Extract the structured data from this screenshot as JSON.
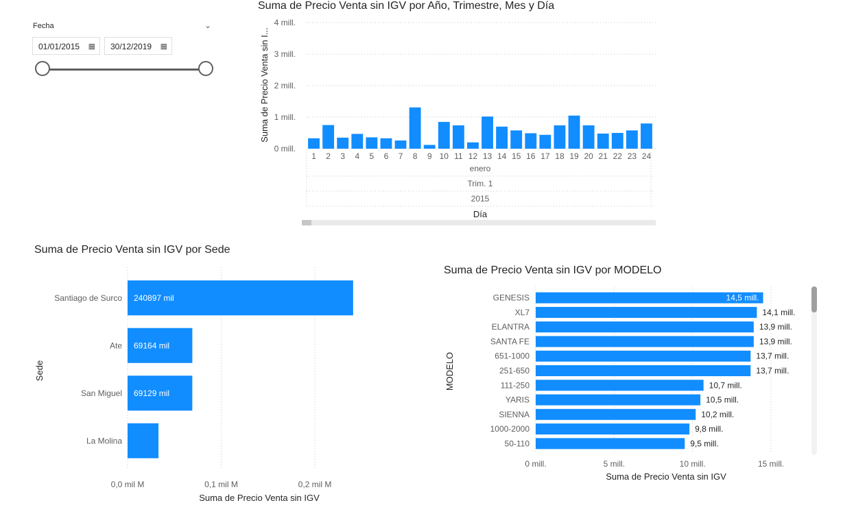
{
  "slicer": {
    "label": "Fecha",
    "chevron_icon": "chevron-down-icon",
    "start_date": "01/01/2015",
    "end_date": "30/12/2019",
    "calendar_icon": "calendar-icon",
    "range_fraction": [
      0,
      1
    ]
  },
  "chart_data": [
    {
      "type": "bar",
      "title": "Suma de Precio Venta sin IGV por Año, Trimestre, Mes y Día",
      "xlabel": "Día",
      "ylabel": "Suma de Precio Venta sin I...",
      "categories": [
        "1",
        "2",
        "3",
        "4",
        "5",
        "6",
        "7",
        "8",
        "9",
        "10",
        "11",
        "12",
        "13",
        "14",
        "15",
        "16",
        "17",
        "18",
        "19",
        "20",
        "21",
        "22",
        "23",
        "24"
      ],
      "values": [
        0.33,
        0.75,
        0.35,
        0.47,
        0.36,
        0.33,
        0.26,
        1.31,
        0.12,
        0.85,
        0.74,
        0.2,
        1.02,
        0.7,
        0.58,
        0.49,
        0.44,
        0.74,
        1.05,
        0.74,
        0.48,
        0.5,
        0.58,
        0.8
      ],
      "ylim": [
        0,
        4
      ],
      "yticks": [
        "0 mill.",
        "1 mill.",
        "2 mill.",
        "3 mill.",
        "4 mill."
      ],
      "hierarchy_labels": [
        "enero",
        "Trim. 1",
        "2015"
      ],
      "color": "#118dff",
      "grid": true
    },
    {
      "type": "bar",
      "orientation": "horizontal",
      "title": "Suma de Precio Venta sin IGV por Sede",
      "xlabel": "Suma de Precio Venta sin IGV",
      "ylabel": "Sede",
      "categories": [
        "Santiago de Surco",
        "Ate",
        "San Miguel",
        "La Molina"
      ],
      "values": [
        240897,
        69164,
        69129,
        33000
      ],
      "data_labels": [
        "240897 mil",
        "69164 mil",
        "69129 mil",
        ""
      ],
      "xlim": [
        0,
        0.25
      ],
      "xticks": [
        "0,0 mil M",
        "0,1 mil M",
        "0,2 mil M"
      ],
      "color": "#118dff",
      "grid": true
    },
    {
      "type": "bar",
      "orientation": "horizontal",
      "title": "Suma de Precio Venta sin IGV por MODELO",
      "xlabel": "Suma de Precio Venta sin IGV",
      "ylabel": "MODELO",
      "categories": [
        "GENESIS",
        "XL7",
        "ELANTRA",
        "SANTA FE",
        "651-1000",
        "251-650",
        "111-250",
        "YARIS",
        "SIENNA",
        "1000-2000",
        "50-110"
      ],
      "values": [
        14.5,
        14.1,
        13.9,
        13.9,
        13.7,
        13.7,
        10.7,
        10.5,
        10.2,
        9.8,
        9.5
      ],
      "data_labels": [
        "14,5 mill.",
        "14,1 mill.",
        "13,9 mill.",
        "13,9 mill.",
        "13,7 mill.",
        "13,7 mill.",
        "10,7 mill.",
        "10,5 mill.",
        "10,2 mill.",
        "9,8 mill.",
        "9,5 mill."
      ],
      "xlim": [
        0,
        15
      ],
      "xticks": [
        "0 mill.",
        "5 mill.",
        "10 mill.",
        "15 mill."
      ],
      "color": "#118dff",
      "grid": true
    }
  ]
}
